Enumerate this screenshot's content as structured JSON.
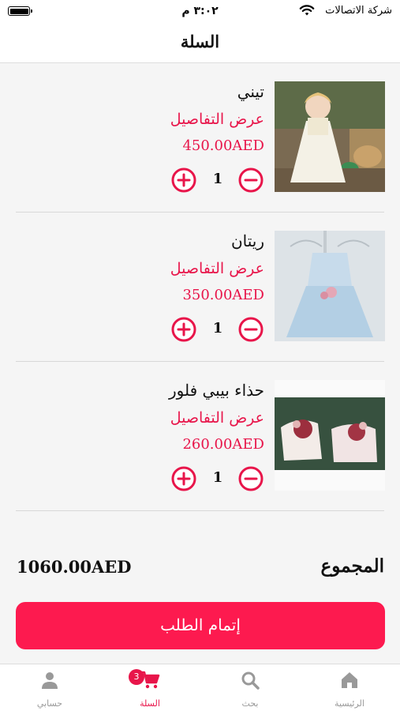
{
  "status_bar": {
    "time": "٣:٠٢ م",
    "carrier": "شركة الاتصالات"
  },
  "header": {
    "title": "السلة"
  },
  "cart": {
    "items": [
      {
        "name": "تيني",
        "details_label": "عرض التفاصيل",
        "price": "450.00AED",
        "quantity": "1"
      },
      {
        "name": "ريتان",
        "details_label": "عرض التفاصيل",
        "price": "350.00AED",
        "quantity": "1"
      },
      {
        "name": "حذاء بيبي فلور",
        "details_label": "عرض التفاصيل",
        "price": "260.00AED",
        "quantity": "1"
      }
    ],
    "total_label": "المجموع",
    "total_value": "1060.00AED",
    "checkout_label": "إتمام الطلب"
  },
  "tabbar": {
    "tabs": [
      {
        "label": "الرئيسية",
        "icon": "home-icon"
      },
      {
        "label": "بحث",
        "icon": "search-icon"
      },
      {
        "label": "السلة",
        "icon": "cart-icon",
        "badge": "3",
        "active": true
      },
      {
        "label": "حسابي",
        "icon": "person-icon"
      }
    ]
  },
  "colors": {
    "accent": "#e8154a",
    "button": "#fd1a4f",
    "background": "#f5f5f5"
  }
}
